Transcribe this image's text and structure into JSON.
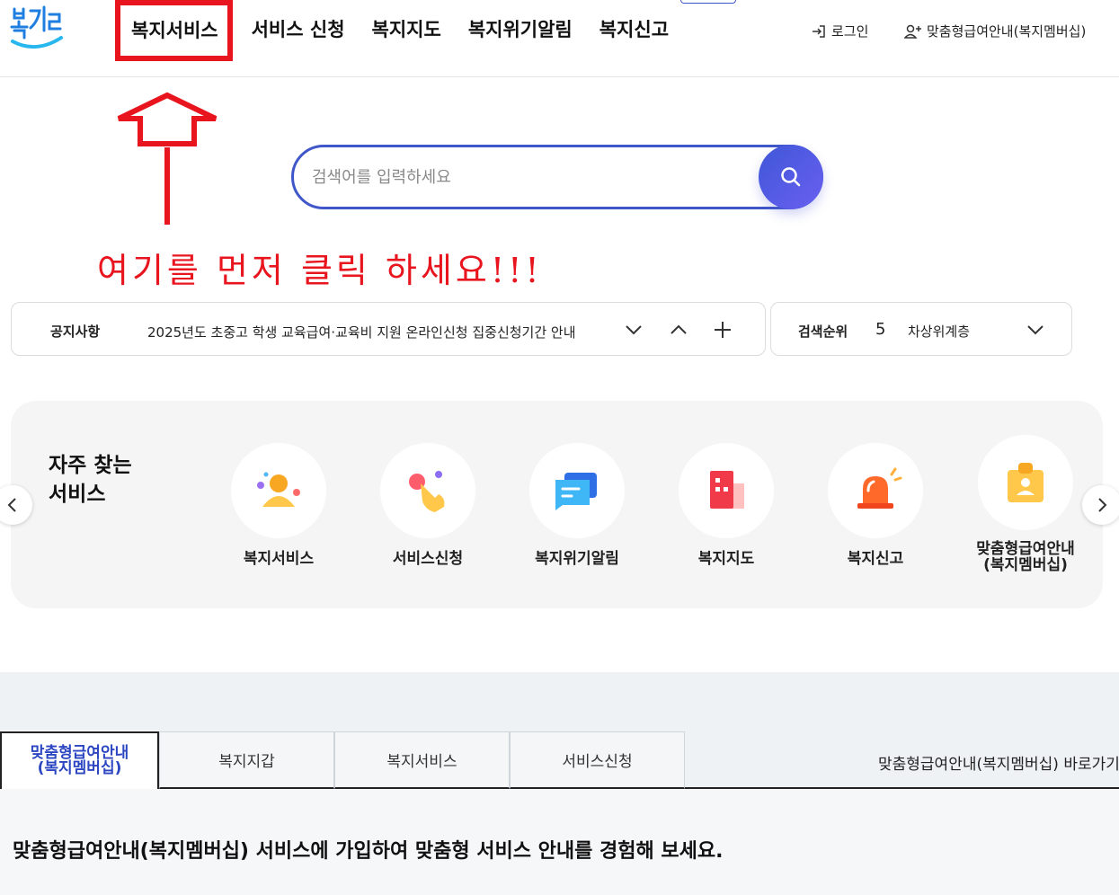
{
  "header": {
    "logo_text": "복지로",
    "nav": [
      "복지서비스",
      "서비스 신청",
      "복지지도",
      "복지위기알림",
      "복지신고"
    ],
    "login_label": "로그인",
    "member_label": "맞춤형급여안내(복지멤버십)"
  },
  "annotation": {
    "text": "여기를 먼저 클릭 하세요!!!",
    "color": "#e8141e"
  },
  "search": {
    "placeholder": "검색어를 입력하세요",
    "value": ""
  },
  "notice": {
    "label": "공지사항",
    "text": "2025년도 초중고 학생 교육급여·교육비 지원 온라인신청 집중신청기간 안내"
  },
  "ranking": {
    "label": "검색순위",
    "rank": "5",
    "term": "차상위계층"
  },
  "quick": {
    "title_line1": "자주 찾는",
    "title_line2": "서비스",
    "items": [
      {
        "icon": "person-icon",
        "label": "복지서비스"
      },
      {
        "icon": "hand-pointer-icon",
        "label": "서비스신청"
      },
      {
        "icon": "message-icon",
        "label": "복지위기알림"
      },
      {
        "icon": "building-icon",
        "label": "복지지도"
      },
      {
        "icon": "siren-icon",
        "label": "복지신고"
      },
      {
        "icon": "membership-card-icon",
        "label_line1": "맞춤형급여안내",
        "label_line2": "(복지멤버십)"
      }
    ]
  },
  "tabs": {
    "items": [
      {
        "label_line1": "맞춤형급여안내",
        "label_line2": "(복지멤버십)"
      },
      {
        "label": "복지지갑"
      },
      {
        "label": "복지서비스"
      },
      {
        "label": "서비스신청"
      }
    ],
    "shortcut": "맞춤형급여안내(복지멤버십) 바로가기",
    "panel_text": "맞춤형급여안내(복지멤버십) 서비스에 가입하여 맞춤형 서비스 안내를 경험해 보세요."
  },
  "colors": {
    "accent": "#3f57c8",
    "annotation_red": "#e8141e",
    "active_tab": "#2c46c2"
  }
}
